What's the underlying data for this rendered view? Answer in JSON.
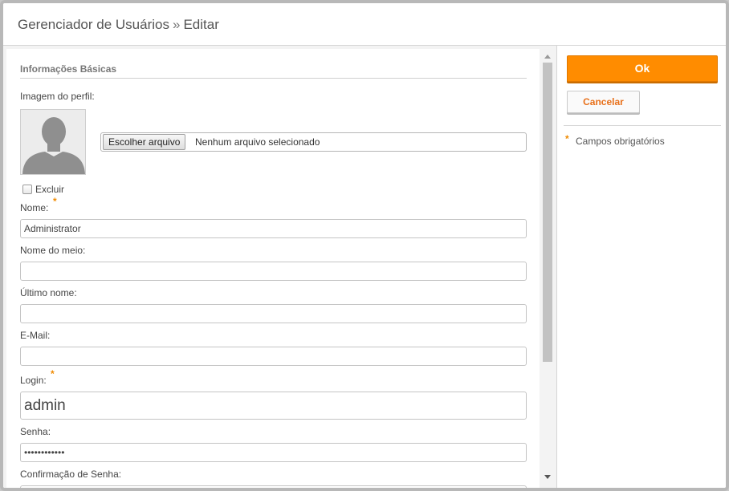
{
  "header": {
    "breadcrumb_parent": "Gerenciador de Usuários",
    "separator": "»",
    "breadcrumb_current": "Editar"
  },
  "form": {
    "section_title": "Informações Básicas",
    "profile_image_label": "Imagem do perfil:",
    "file_button_label": "Escolher arquivo",
    "file_status": "Nenhum arquivo selecionado",
    "delete_label": "Excluir",
    "delete_checked": false,
    "required_marker": "*",
    "fields": {
      "first_name": {
        "label": "Nome:",
        "value": "Administrator",
        "required": true
      },
      "middle_name": {
        "label": "Nome do meio:",
        "value": ""
      },
      "last_name": {
        "label": "Último nome:",
        "value": ""
      },
      "email": {
        "label": "E-Mail:",
        "value": ""
      },
      "login": {
        "label": "Login:",
        "value": "admin",
        "required": true
      },
      "password": {
        "label": "Senha:",
        "value": "••••••••••••"
      },
      "password_confirm": {
        "label": "Confirmação de Senha:",
        "value": ""
      }
    }
  },
  "side": {
    "ok_label": "Ok",
    "cancel_label": "Cancelar",
    "required_note": "Campos obrigatórios"
  },
  "colors": {
    "accent": "#ff8c00",
    "cancel_text": "#e8701a",
    "required_marker": "#f08a00"
  },
  "icons": {
    "avatar": "user-silhouette-icon",
    "scroll_up": "scroll-up-arrow-icon",
    "scroll_down": "scroll-down-arrow-icon"
  }
}
